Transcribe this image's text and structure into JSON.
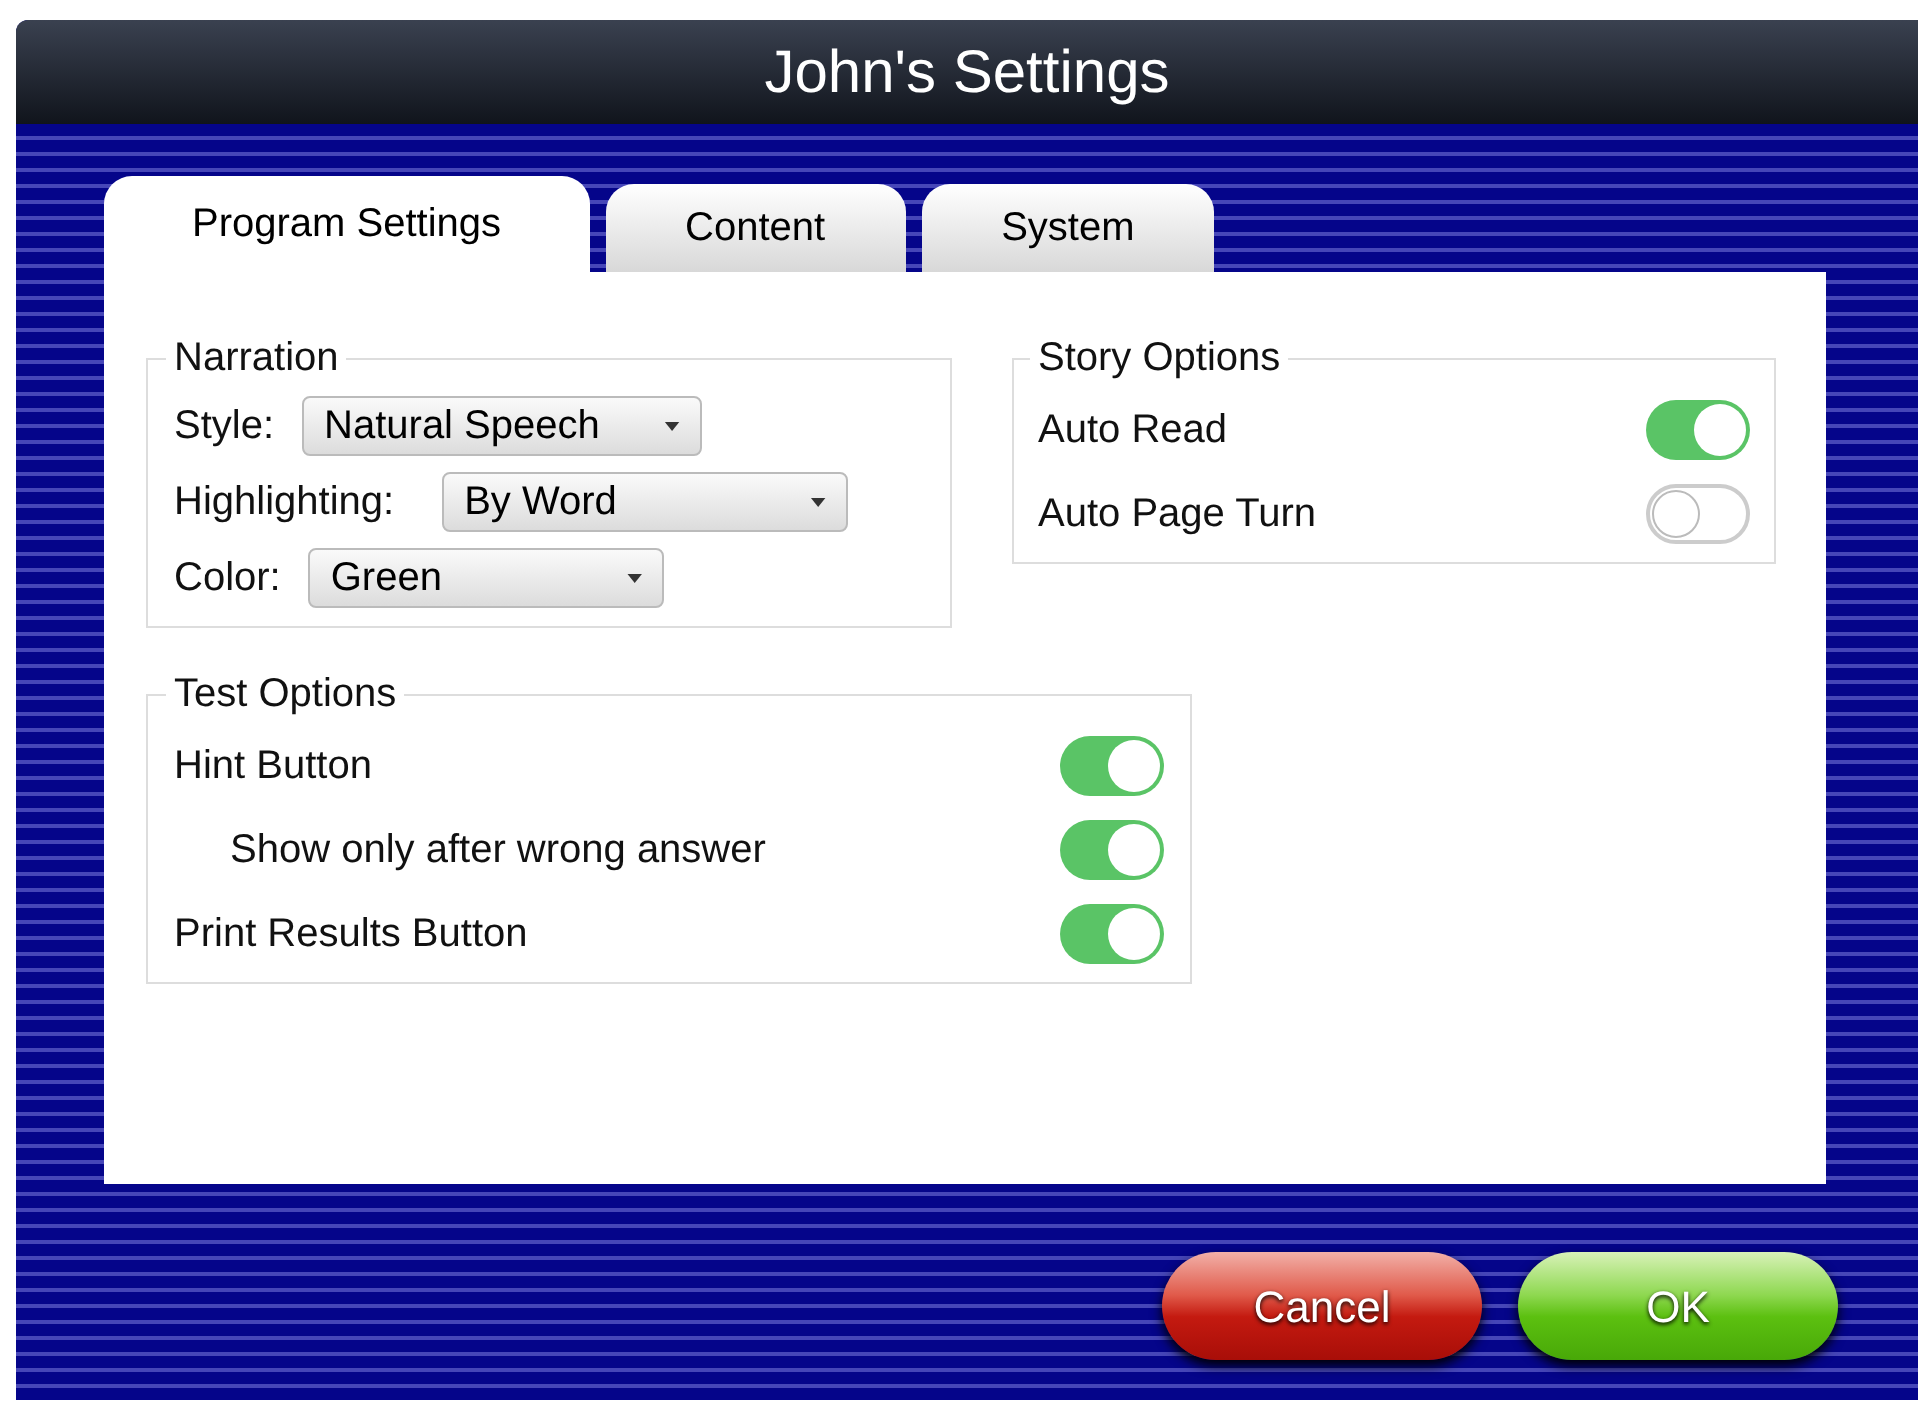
{
  "window": {
    "title": "John's Settings"
  },
  "tabs": [
    {
      "label": "Program Settings",
      "selected": true
    },
    {
      "label": "Content",
      "selected": false
    },
    {
      "label": "System",
      "selected": false
    }
  ],
  "narration": {
    "title": "Narration",
    "rows": [
      {
        "label": "Style:",
        "value": "Natural Speech"
      },
      {
        "label": "Highlighting:",
        "value": "By Word"
      },
      {
        "label": "Color:",
        "value": "Green"
      }
    ]
  },
  "story_options": {
    "title": "Story Options",
    "items": [
      {
        "label": "Auto Read",
        "on": true
      },
      {
        "label": "Auto Page Turn",
        "on": false
      }
    ]
  },
  "test_options": {
    "title": "Test Options",
    "items": [
      {
        "label": "Hint Button",
        "on": true,
        "children": [
          {
            "label": "Show only after wrong answer",
            "on": true
          }
        ]
      },
      {
        "label": "Print Results Button",
        "on": true
      }
    ]
  },
  "buttons": [
    {
      "label": "Cancel",
      "kind": "cancel"
    },
    {
      "label": "OK",
      "kind": "ok"
    }
  ]
}
